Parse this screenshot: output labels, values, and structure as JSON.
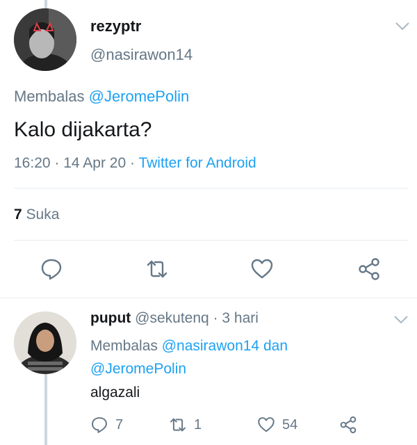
{
  "main_tweet": {
    "display_name": "rezyptr",
    "handle": "@nasirawon14",
    "replying_label": "Membalas",
    "replying_to": "@JeromePolin",
    "text": "Kalo dijakarta?",
    "time": "16:20",
    "date": "14 Apr 20",
    "source": "Twitter for Android",
    "sep": "·",
    "likes_count": "7",
    "likes_label": "Suka"
  },
  "reply": {
    "display_name": "puput",
    "handle": "@sekutenq",
    "sep": "·",
    "age": "3 hari",
    "replying_label": "Membalas",
    "replying_to_1": "@nasirawon14",
    "and_label": "dan",
    "replying_to_2": "@JeromePolin",
    "text": "algazali",
    "reply_count": "7",
    "retweet_count": "1",
    "like_count": "54"
  },
  "icons": {
    "reply": "reply-icon",
    "retweet": "retweet-icon",
    "like": "heart-icon",
    "share": "share-icon",
    "caret": "chevron-down-icon"
  },
  "colors": {
    "accent": "#1da1f2",
    "secondary_text": "#657786",
    "primary_text": "#14171a",
    "divider": "#e6ecf0",
    "thread_line": "#ccd6dd"
  }
}
